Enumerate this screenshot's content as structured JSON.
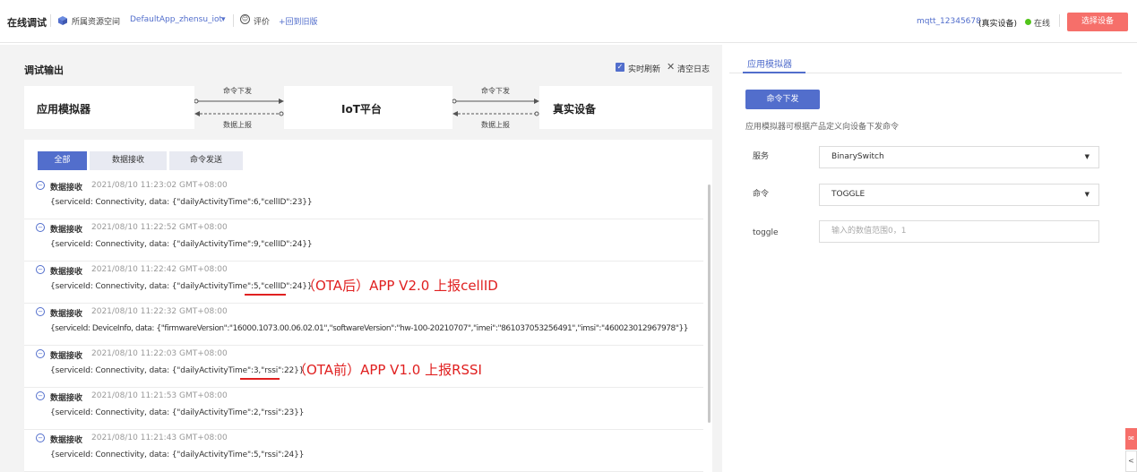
{
  "header": {
    "title": "在线调试",
    "space_label": "所属资源空间",
    "app_name": "DefaultApp_zhensu_iot",
    "rate_label": "评价",
    "back_old_label": "+回到旧版",
    "device_name": "mqtt_12345678",
    "device_type": "(真实设备)",
    "status": "在线",
    "select_device_label": "选择设备"
  },
  "debug_output": {
    "title": "调试输出",
    "realtime_refresh_label": "实时刷新",
    "clear_log_label": "清空日志",
    "flow": {
      "app_simulator": "应用模拟器",
      "iot_platform": "IoT平台",
      "real_device": "真实设备",
      "cmd_down_1": "命令下发",
      "data_up_1": "数据上报",
      "cmd_down_2": "命令下发",
      "data_up_2": "数据上报"
    },
    "tabs": [
      "全部",
      "数据接收",
      "命令发送"
    ],
    "entries": [
      {
        "kind": "数据接收",
        "time": "2021/08/10 11:23:02 GMT+08:00",
        "body": "{serviceId: Connectivity, data: {\"dailyActivityTime\":6,\"cellID\":23}}"
      },
      {
        "kind": "数据接收",
        "time": "2021/08/10 11:22:52 GMT+08:00",
        "body": "{serviceId: Connectivity, data: {\"dailyActivityTime\":9,\"cellID\":24}}"
      },
      {
        "kind": "数据接收",
        "time": "2021/08/10 11:22:42 GMT+08:00",
        "body": "{serviceId: Connectivity, data: {\"dailyActivityTime\":5,\"cellID\":24}}",
        "note": "（OTA后）APP V2.0 上报cellID"
      },
      {
        "kind": "数据接收",
        "time": "2021/08/10 11:22:32 GMT+08:00",
        "body": "{serviceId: DeviceInfo, data: {\"firmwareVersion\":\"16000.1073.00.06.02.01\",\"softwareVersion\":\"hw-100-20210707\",\"imei\":\"861037053256491\",\"imsi\":\"460023012967978\"}}"
      },
      {
        "kind": "数据接收",
        "time": "2021/08/10 11:22:03 GMT+08:00",
        "body": "{serviceId: Connectivity, data: {\"dailyActivityTime\":3,\"rssi\":22}}",
        "note": "（OTA前）APP V1.0 上报RSSI"
      },
      {
        "kind": "数据接收",
        "time": "2021/08/10 11:21:53 GMT+08:00",
        "body": "{serviceId: Connectivity, data: {\"dailyActivityTime\":2,\"rssi\":23}}"
      },
      {
        "kind": "数据接收",
        "time": "2021/08/10 11:21:43 GMT+08:00",
        "body": "{serviceId: Connectivity, data: {\"dailyActivityTime\":5,\"rssi\":24}}"
      }
    ]
  },
  "simulator": {
    "tab_label": "应用模拟器",
    "cmd_button_label": "命令下发",
    "hint": "应用模拟器可根据产品定义向设备下发命令",
    "service_label": "服务",
    "service_value": "BinarySwitch",
    "command_label": "命令",
    "command_value": "TOGGLE",
    "toggle_label": "toggle",
    "toggle_placeholder": "输入的数值范围0，1"
  },
  "colors": {
    "accent": "#526ecc",
    "danger": "#f66f6a",
    "online": "#52c41a",
    "annotation": "#e02020"
  }
}
